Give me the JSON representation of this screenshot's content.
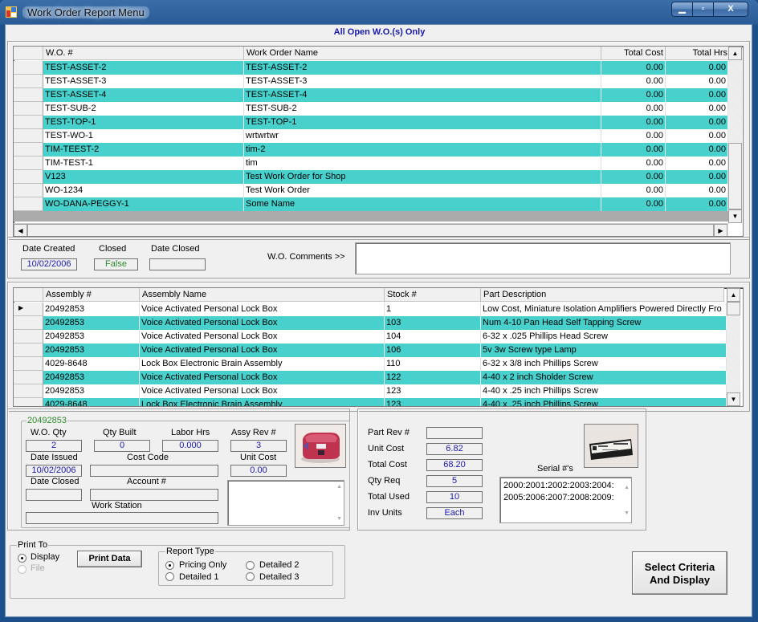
{
  "window": {
    "title": "Work Order Report Menu",
    "controls": {
      "minimize": "—",
      "maximize": "□",
      "close": "X"
    }
  },
  "header_label": "All Open W.O.(s) Only",
  "work_orders": {
    "columns": [
      "W.O. #",
      "Work Order Name",
      "Total Cost",
      "Total Hrs"
    ],
    "rows": [
      [
        "TEST-ASSET-2",
        "TEST-ASSET-2",
        "0.00",
        "0.00"
      ],
      [
        "TEST-ASSET-3",
        "TEST-ASSET-3",
        "0.00",
        "0.00"
      ],
      [
        "TEST-ASSET-4",
        "TEST-ASSET-4",
        "0.00",
        "0.00"
      ],
      [
        "TEST-SUB-2",
        "TEST-SUB-2",
        "0.00",
        "0.00"
      ],
      [
        "TEST-TOP-1",
        "TEST-TOP-1",
        "0.00",
        "0.00"
      ],
      [
        "TEST-WO-1",
        "wrtwrtwr",
        "0.00",
        "0.00"
      ],
      [
        "TIM-TEEST-2",
        "tim-2",
        "0.00",
        "0.00"
      ],
      [
        "TIM-TEST-1",
        "tim",
        "0.00",
        "0.00"
      ],
      [
        "V123",
        "Test Work Order for Shop",
        "0.00",
        "0.00"
      ],
      [
        "WO-1234",
        "Test Work Order",
        "0.00",
        "0.00"
      ],
      [
        "WO-DANA-PEGGY-1",
        "Some Name",
        "0.00",
        "0.00"
      ]
    ]
  },
  "wo_info": {
    "date_created_label": "Date Created",
    "date_created": "10/02/2006",
    "closed_label": "Closed",
    "closed": "False",
    "date_closed_label": "Date Closed",
    "date_closed": "",
    "comments_label": "W.O. Comments >>",
    "comments": ""
  },
  "assemblies": {
    "columns": [
      "Assembly #",
      "Assembly Name",
      "Stock #",
      "Part Description"
    ],
    "rows": [
      [
        "20492853",
        "Voice Activated Personal  Lock Box",
        "1",
        "Low Cost, Miniature Isolation Amplifiers Powered Directly Fro"
      ],
      [
        "20492853",
        "Voice Activated Personal  Lock Box",
        "103",
        "Num 4-10  Pan Head Self Tapping Screw"
      ],
      [
        "20492853",
        "Voice Activated Personal  Lock Box",
        "104",
        "6-32 x .025 Phillips Head Screw"
      ],
      [
        "20492853",
        "Voice Activated Personal  Lock Box",
        "106",
        "5v 3w Screw type Lamp"
      ],
      [
        "4029-8648",
        "Lock Box Electronic Brain Assembly",
        "110",
        "6-32 x 3/8 inch Phillips Screw"
      ],
      [
        "20492853",
        "Voice Activated Personal  Lock Box",
        "122",
        "4-40 x 2 inch Sholder Screw"
      ],
      [
        "20492853",
        "Voice Activated Personal  Lock Box",
        "123",
        "4-40 x .25 inch Phillips Screw"
      ],
      [
        "4029-8648",
        "Lock Box Electronic Brain Assembly",
        "123",
        "4-40 x .25 inch Phillips Screw"
      ]
    ],
    "selected_row": 0
  },
  "assembly_detail": {
    "group_title": "20492853",
    "wo_qty_label": "W.O. Qty",
    "wo_qty": "2",
    "qty_built_label": "Qty Built",
    "qty_built": "0",
    "labor_hrs_label": "Labor Hrs",
    "labor_hrs": "0.000",
    "assy_rev_label": "Assy Rev #",
    "assy_rev": "3",
    "date_issued_label": "Date Issued",
    "date_issued": "10/02/2006",
    "cost_code_label": "Cost Code",
    "cost_code": "",
    "unit_cost_label": "Unit Cost",
    "unit_cost": "0.00",
    "date_closed_label": "Date Closed",
    "date_closed": "",
    "account_label": "Account #",
    "account": "",
    "work_station_label": "Work Station",
    "work_station": "",
    "notes": "",
    "image_icon": "lock-box-photo"
  },
  "part_detail": {
    "part_rev_label": "Part Rev #",
    "part_rev": "",
    "unit_cost_label": "Unit Cost",
    "unit_cost": "6.82",
    "total_cost_label": "Total Cost",
    "total_cost": "68.20",
    "qty_req_label": "Qty Req",
    "qty_req": "5",
    "total_used_label": "Total Used",
    "total_used": "10",
    "inv_units_label": "Inv Units",
    "inv_units": "Each",
    "serials_label": "Serial #'s",
    "serials_line1": "2000:2001:2002:2003:2004:",
    "serials_line2": "2005:2006:2007:2008:2009:",
    "image_icon": "amplifier-chip-photo"
  },
  "print_to": {
    "title": "Print To",
    "options": [
      {
        "label": "Display",
        "checked": true,
        "enabled": true
      },
      {
        "label": "File",
        "checked": false,
        "enabled": false
      }
    ],
    "print_button": "Print Data"
  },
  "report_type": {
    "title": "Report Type",
    "options": [
      {
        "label": "Pricing Only",
        "checked": true
      },
      {
        "label": "Detailed 2",
        "checked": false
      },
      {
        "label": "Detailed 1",
        "checked": false
      },
      {
        "label": "Detailed 3",
        "checked": false
      }
    ]
  },
  "select_button": {
    "line1": "Select Criteria",
    "line2": "And Display"
  },
  "colors": {
    "row_highlight": "#48d1cc",
    "value_text": "#1a1aaa",
    "closed_text": "#2e8b2e",
    "header_text": "#1a1aaa"
  }
}
